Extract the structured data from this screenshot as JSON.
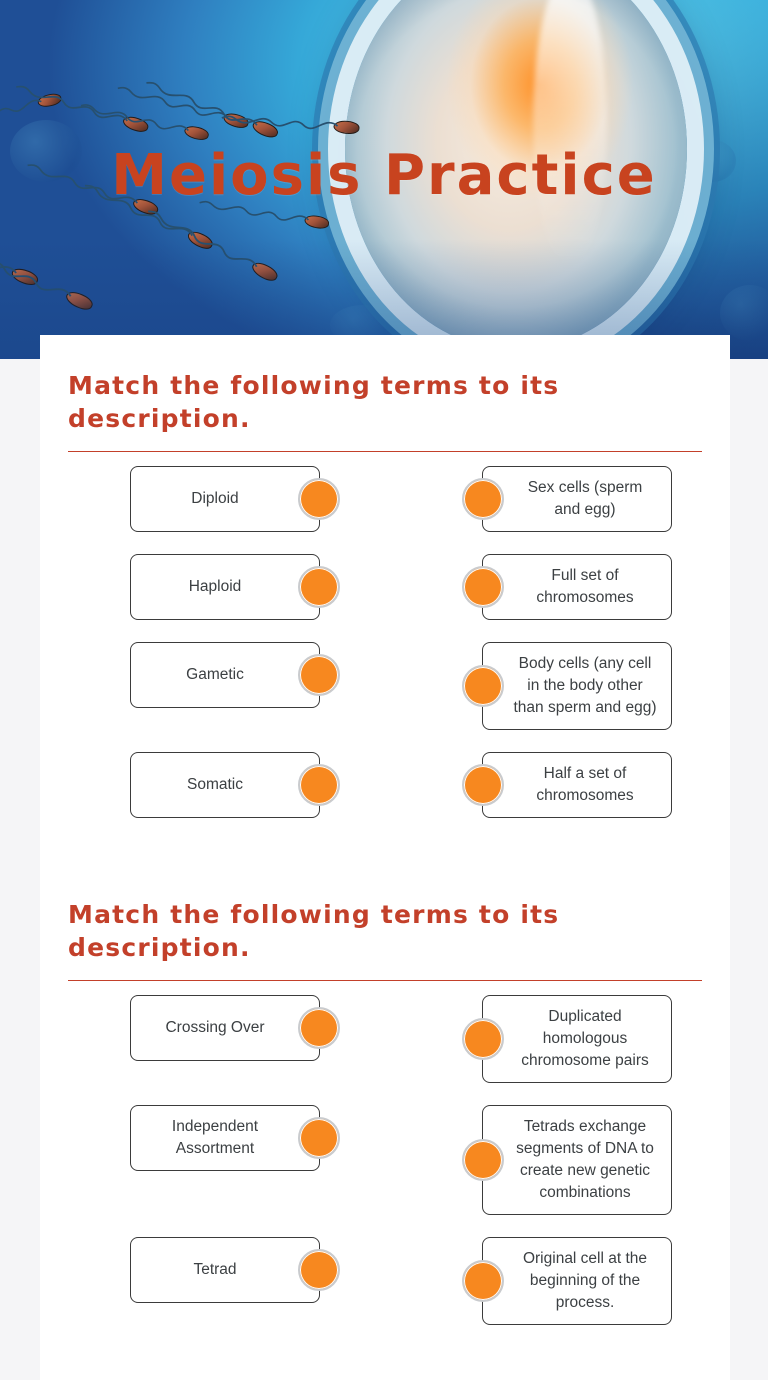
{
  "page": {
    "title": "Meiosis Practice",
    "title_color": "#c8431f",
    "accent_color": "#c3402a",
    "dot_color": "#f7881f",
    "card_background": "#ffffff",
    "page_background": "#f5f5f7"
  },
  "hero": {
    "alt": "Illustration of sperm cells swimming toward an egg cell on a blue background",
    "title": "Meiosis Practice"
  },
  "sections": [
    {
      "heading": "Match the following terms to its description.",
      "rows": [
        {
          "term": "Diploid",
          "description": "Sex cells (sperm and egg)"
        },
        {
          "term": "Haploid",
          "description": "Full set of chromosomes"
        },
        {
          "term": "Gametic",
          "description": "Body cells (any cell in the body other than sperm and egg)"
        },
        {
          "term": "Somatic",
          "description": "Half a set of chromosomes"
        }
      ]
    },
    {
      "heading": "Match the following terms to its description.",
      "rows": [
        {
          "term": "Crossing Over",
          "description": "Duplicated homologous chromosome pairs"
        },
        {
          "term": "Independent Assortment",
          "description": "Tetrads exchange segments of DNA to create new genetic combinations"
        },
        {
          "term": "Tetrad",
          "description": "Original cell at the beginning of the process."
        }
      ]
    }
  ]
}
